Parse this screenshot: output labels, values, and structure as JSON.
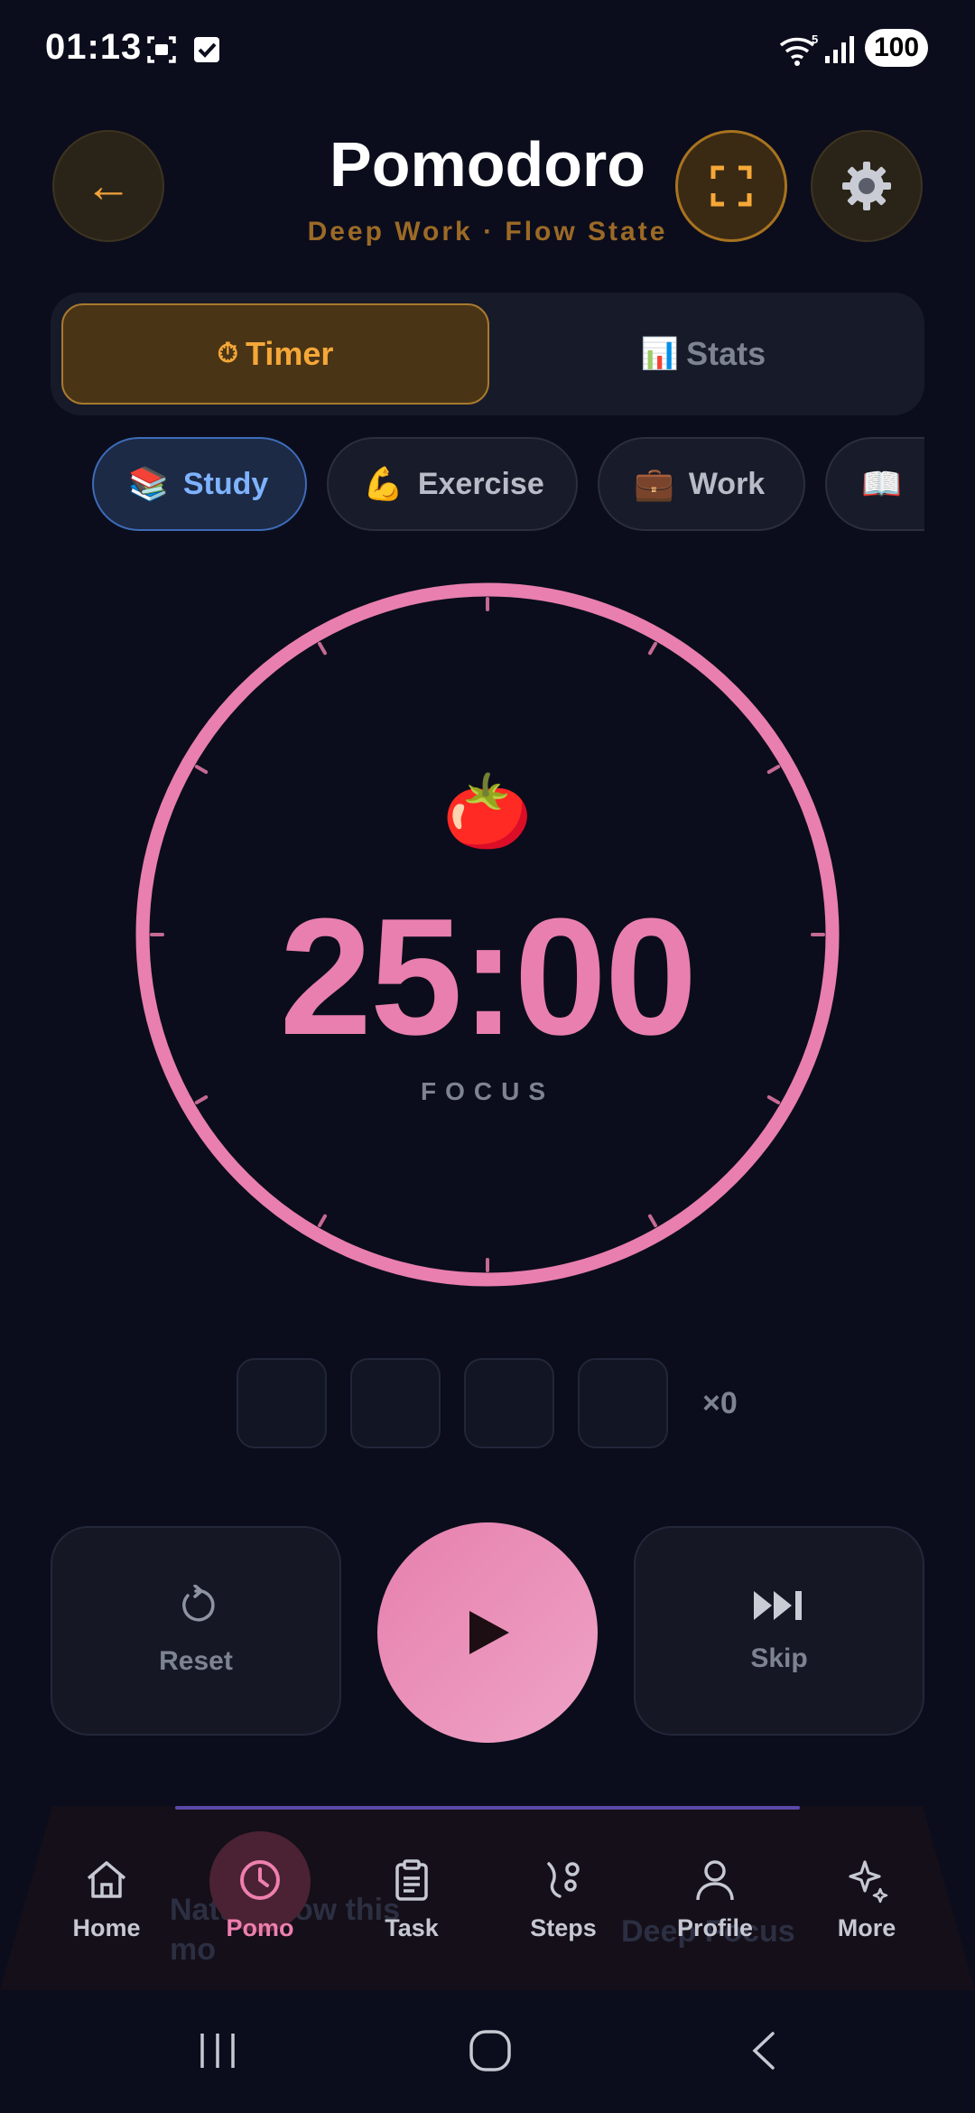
{
  "status_bar": {
    "time": "01:13",
    "battery": "100",
    "icons": [
      "screenshot-icon",
      "check-square-icon",
      "wifi-icon",
      "signal-icon"
    ]
  },
  "header": {
    "title": "Pomodoro",
    "subtitle": "Deep Work · Flow State",
    "back_icon": "←"
  },
  "tabs": [
    {
      "icon": "⏱",
      "label": "Timer",
      "active": true
    },
    {
      "icon": "📊",
      "label": "Stats",
      "active": false
    }
  ],
  "categories": [
    {
      "icon": "📚",
      "label": "Study",
      "active": true
    },
    {
      "icon": "💪",
      "label": "Exercise",
      "active": false
    },
    {
      "icon": "💼",
      "label": "Work",
      "active": false
    },
    {
      "icon": "📖",
      "label": "",
      "active": false
    }
  ],
  "timer": {
    "icon": "🍅",
    "time": "25:00",
    "phase": "FOCUS",
    "progress": 0
  },
  "sessions": {
    "count_label": "×0",
    "dots": [
      "",
      "",
      "",
      ""
    ]
  },
  "controls": {
    "reset_label": "Reset",
    "skip_label": "Skip"
  },
  "background_cards": {
    "left_text_1": "Nature flow this",
    "left_text_2": "mo",
    "right_text": "Deep Focus"
  },
  "nav": [
    {
      "label": "Home",
      "icon": "home-icon"
    },
    {
      "label": "Pomo",
      "icon": "clock-icon",
      "active": true
    },
    {
      "label": "Task",
      "icon": "clipboard-icon"
    },
    {
      "label": "Steps",
      "icon": "steps-icon"
    },
    {
      "label": "Profile",
      "icon": "user-icon"
    },
    {
      "label": "More",
      "icon": "sparkles-icon"
    }
  ],
  "colors": {
    "background": "#0b0d1c",
    "accent_orange": "#f5a838",
    "accent_pink": "#e97fae",
    "chip_active_blue": "#7fb2ff"
  }
}
